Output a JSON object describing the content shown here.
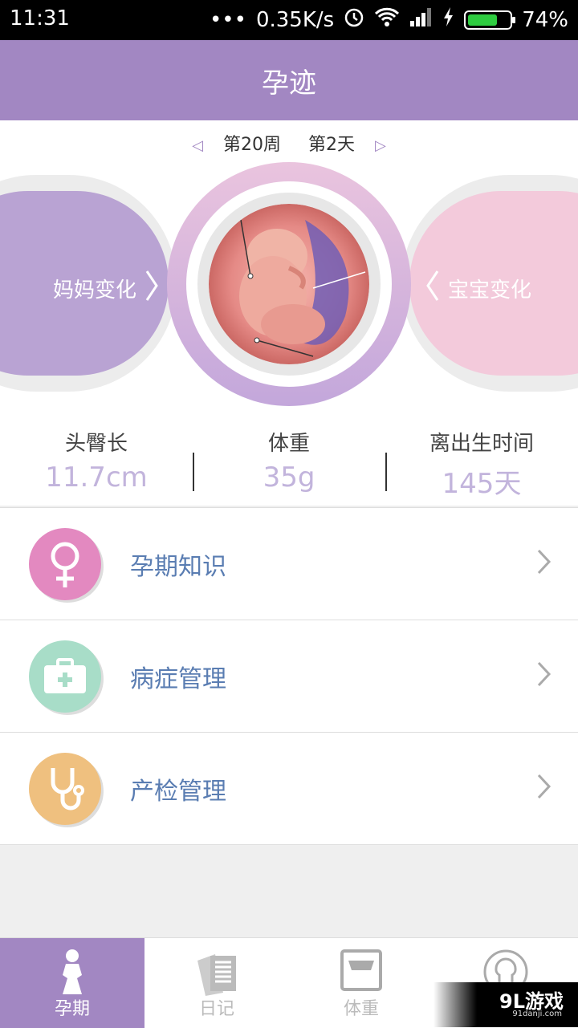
{
  "status_bar": {
    "time": "11:31",
    "dots": "•••",
    "net_speed": "0.35K/s",
    "battery_pct": "74%",
    "battery_level": 0.74
  },
  "app_bar": {
    "title": "孕迹"
  },
  "week_nav": {
    "week": "第20周",
    "day": "第2天"
  },
  "hero": {
    "mom_label": "妈妈变化",
    "baby_label": "宝宝变化"
  },
  "stats": [
    {
      "label": "头臀长",
      "value": "11.7cm"
    },
    {
      "label": "体重",
      "value": "35g"
    },
    {
      "label": "离出生时间",
      "value": "145天"
    }
  ],
  "menu": [
    {
      "label": "孕期知识",
      "icon": "female-symbol-icon",
      "color": "#e389c0"
    },
    {
      "label": "病症管理",
      "icon": "medical-kit-icon",
      "color": "#a8ddc8"
    },
    {
      "label": "产检管理",
      "icon": "stethoscope-icon",
      "color": "#efc07f"
    }
  ],
  "tabs": [
    {
      "label": "孕期",
      "icon": "pregnant-woman-icon",
      "active": true
    },
    {
      "label": "日记",
      "icon": "diary-icon",
      "active": false
    },
    {
      "label": "体重",
      "icon": "scale-icon",
      "active": false
    },
    {
      "label": "",
      "icon": "profile-icon",
      "active": false
    }
  ],
  "watermark": {
    "brand": "9L游戏",
    "domain": "91danji.com"
  },
  "colors": {
    "primary": "#a287c2",
    "accent_text": "#5a7db2",
    "stat_value": "#c2b4dc"
  }
}
